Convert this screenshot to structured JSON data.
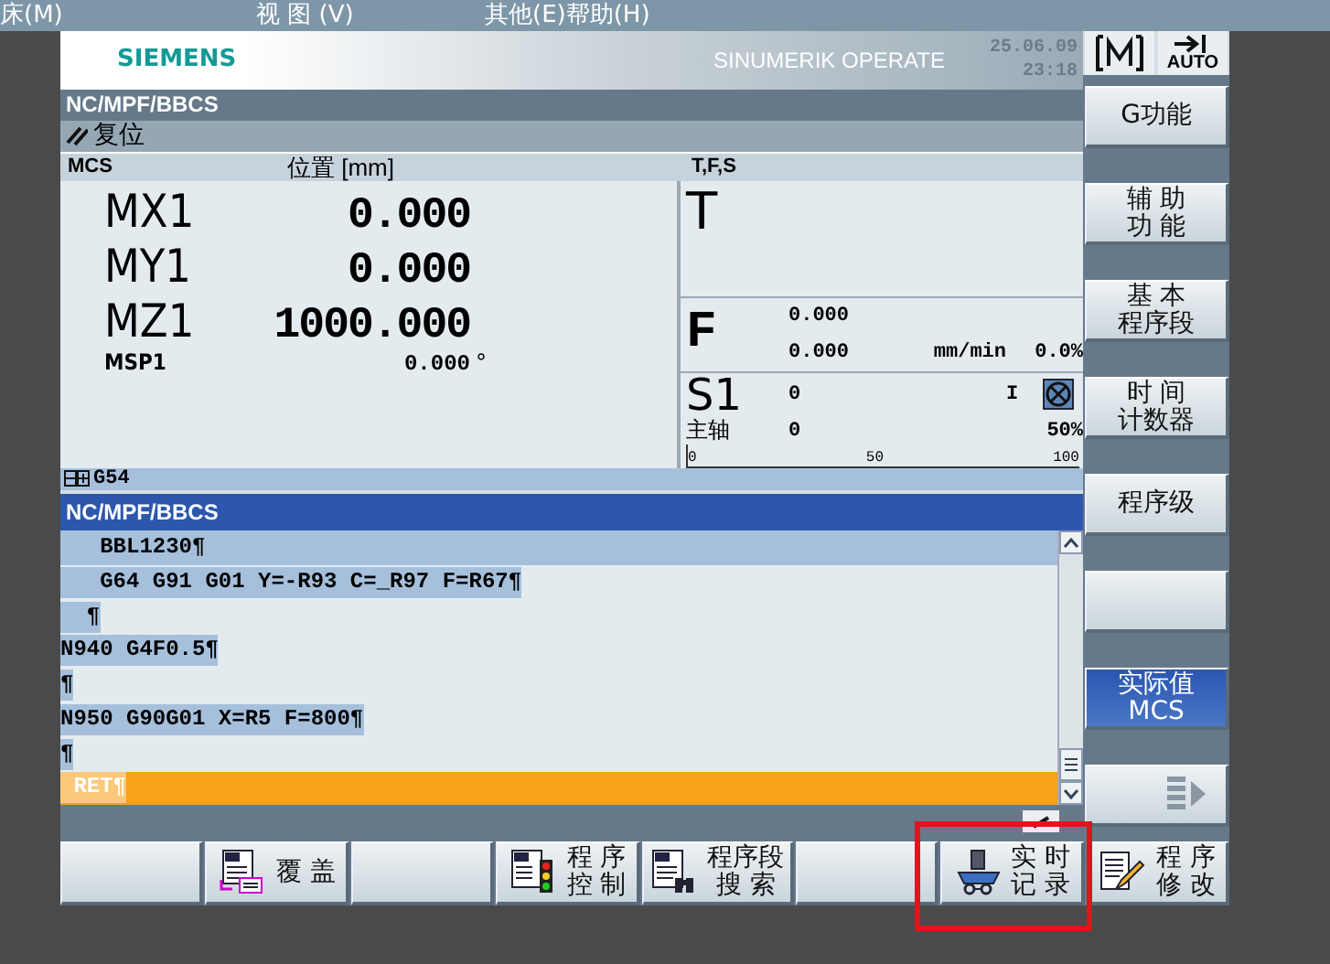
{
  "menu_bar": [
    "床(M)",
    "视 图 (V)",
    "其他(E)",
    "帮助(H)"
  ],
  "header": {
    "brand": "SIEMENS",
    "product": "SINUMERIK OPERATE",
    "date": "25.06.09",
    "time": "23:18",
    "mode": "AUTO"
  },
  "program_path": "NC/MPF/BBCS",
  "channel_status": "复位",
  "position_table": {
    "columns": [
      "MCS",
      "位置 [mm]"
    ],
    "axes": [
      {
        "kind": "linear",
        "name": "MX1",
        "value": "0.000"
      },
      {
        "kind": "linear",
        "name": "MY1",
        "value": "0.000"
      },
      {
        "kind": "linear",
        "name": "MZ1",
        "value": "1000.000"
      },
      {
        "kind": "spindle",
        "name": "MSP1",
        "value": "0.000",
        "unit": "°"
      }
    ],
    "work_offset": "G54"
  },
  "tfs": {
    "title": "T,F,S",
    "tool_label": "T",
    "feed_label": "F",
    "feed_set": "0.000",
    "feed_actual": "0.000",
    "feed_unit": "mm/min",
    "feed_override": "0.0%",
    "spindle_label": "S1",
    "spindle_name": "主轴",
    "spindle_set": "0",
    "spindle_direction": "I",
    "spindle_actual": "0",
    "spindle_override": "50%",
    "scale_ticks": [
      "0",
      "50",
      "100"
    ]
  },
  "program": {
    "title": "NC/MPF/BBCS",
    "lines": [
      {
        "text": "   BBL1230¶",
        "kind": "active"
      },
      {
        "text": "   G64 G91 G01 Y=-R93 C=_R97 F=R67¶",
        "kind": "normal"
      },
      {
        "text": "  ¶",
        "kind": "normal"
      },
      {
        "text": "N940 G4F0.5¶",
        "kind": "normal"
      },
      {
        "text": "¶",
        "kind": "normal"
      },
      {
        "text": "N950 G90G01 X=R5 F=800¶",
        "kind": "normal"
      },
      {
        "text": "¶",
        "kind": "normal"
      },
      {
        "text": " RET¶",
        "kind": "cursor"
      }
    ]
  },
  "vertical_softkeys": [
    {
      "kind": "text",
      "lines": [
        "G功能"
      ],
      "selected": false
    },
    {
      "kind": "text",
      "lines": [
        "辅 助",
        "功 能"
      ],
      "selected": false
    },
    {
      "kind": "text",
      "lines": [
        "基 本",
        "程序段"
      ],
      "selected": false
    },
    {
      "kind": "text",
      "lines": [
        "时 间",
        "计数器"
      ],
      "selected": false
    },
    {
      "kind": "text",
      "lines": [
        "程序级"
      ],
      "selected": false
    },
    {
      "kind": "blank",
      "selected": false
    },
    {
      "kind": "text",
      "lines": [
        "实际值",
        "MCS"
      ],
      "selected": true
    },
    {
      "kind": "more",
      "selected": false
    }
  ],
  "horizontal_softkeys": [
    {
      "kind": "blank",
      "highlighted": false
    },
    {
      "kind": "overlay",
      "lines": [
        "覆 盖"
      ],
      "highlighted": false
    },
    {
      "kind": "blank",
      "highlighted": false
    },
    {
      "kind": "traffic",
      "lines": [
        "程 序",
        "控 制"
      ],
      "highlighted": false
    },
    {
      "kind": "binoculars",
      "lines": [
        "程序段",
        "搜 索"
      ],
      "highlighted": false
    },
    {
      "kind": "blank",
      "highlighted": false
    },
    {
      "kind": "recorder",
      "lines": [
        "实 时",
        "记 录"
      ],
      "highlighted": true
    },
    {
      "kind": "pencil",
      "lines": [
        "程 序",
        "修 改"
      ],
      "highlighted": false
    }
  ]
}
